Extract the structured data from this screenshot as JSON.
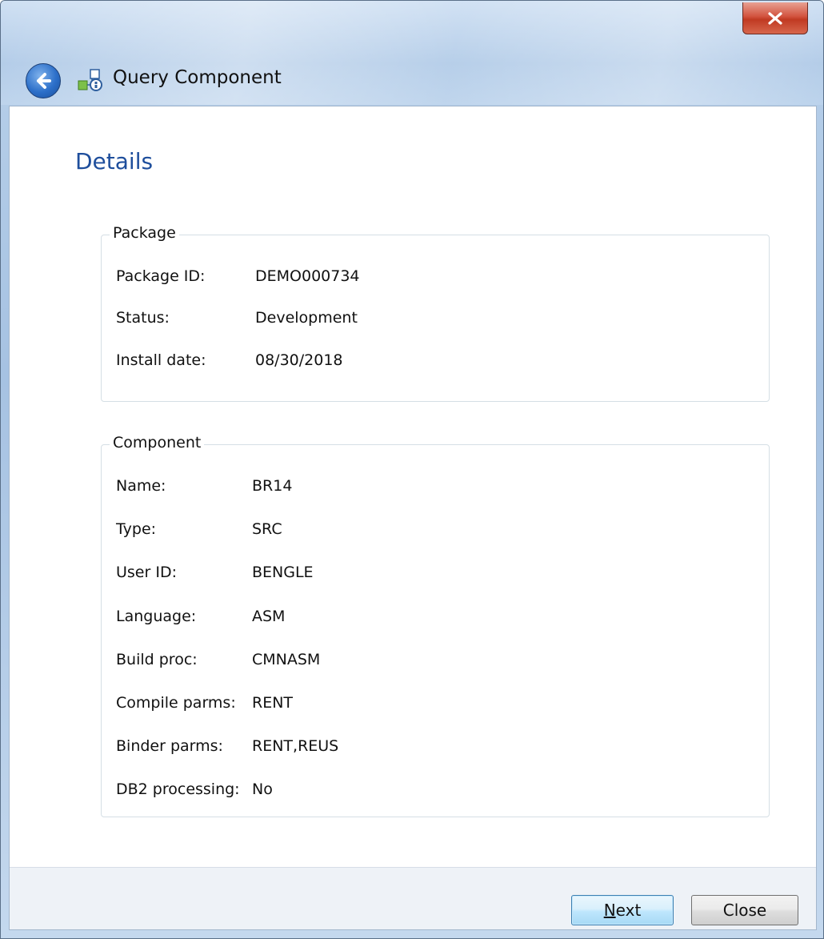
{
  "window": {
    "title": "Query Component",
    "close_glyph": "x"
  },
  "icons": {
    "back": "back-arrow-icon",
    "title": "query-component-icon",
    "close": "close-icon"
  },
  "page": {
    "heading": "Details"
  },
  "package": {
    "legend": "Package",
    "fields": [
      {
        "label": "Package ID:",
        "value": "DEMO000734"
      },
      {
        "label": "Status:",
        "value": "Development"
      },
      {
        "label": "Install date:",
        "value": "08/30/2018"
      }
    ]
  },
  "component": {
    "legend": "Component",
    "fields": [
      {
        "label": "Name:",
        "value": "BR14"
      },
      {
        "label": "Type:",
        "value": "SRC"
      },
      {
        "label": "User ID:",
        "value": "BENGLE"
      },
      {
        "label": "Language:",
        "value": "ASM"
      },
      {
        "label": "Build proc:",
        "value": "CMNASM"
      },
      {
        "label": "Compile parms:",
        "value": "RENT"
      },
      {
        "label": "Binder parms:",
        "value": "RENT,REUS"
      },
      {
        "label": "DB2 processing:",
        "value": "No"
      }
    ]
  },
  "buttons": {
    "next_accel": "N",
    "next_rest": "ext",
    "close": "Close"
  },
  "colors": {
    "heading": "#1e4e9c",
    "close_button": "#c03a22",
    "default_button_border": "#3c7fb1"
  }
}
